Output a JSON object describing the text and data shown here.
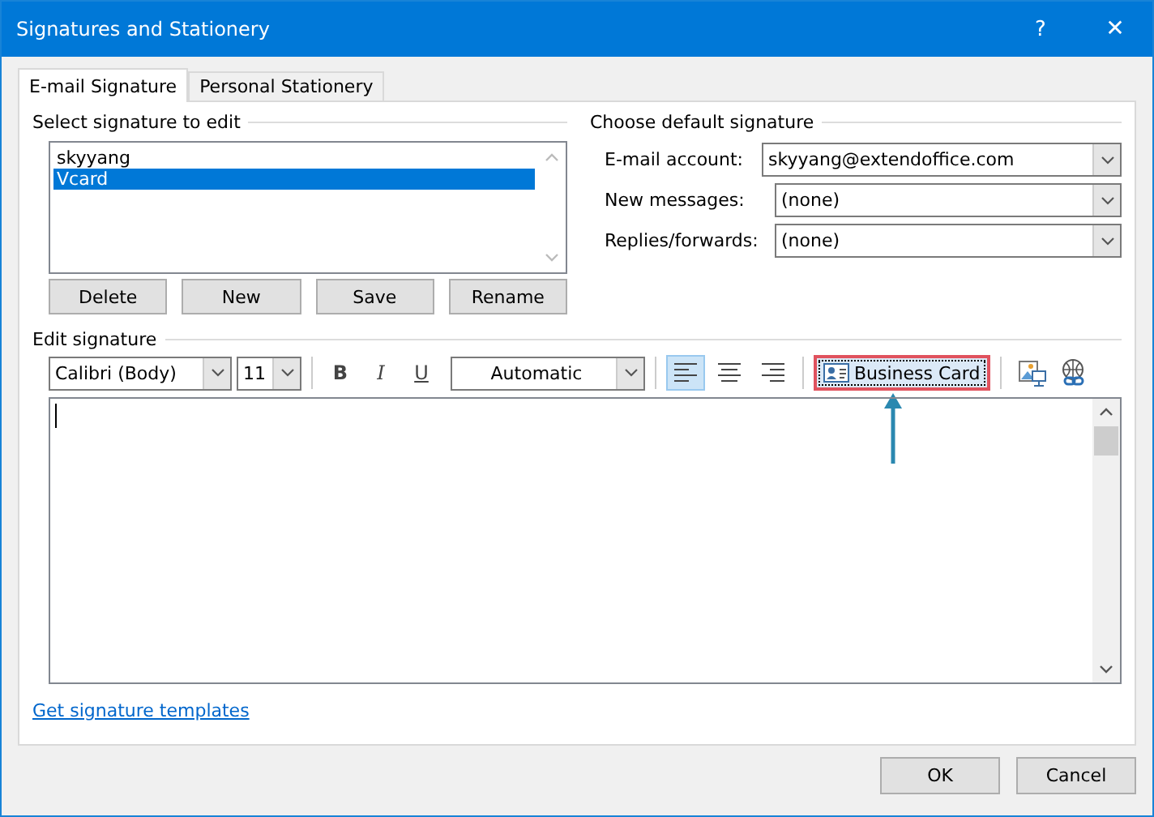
{
  "window": {
    "title": "Signatures and Stationery",
    "buttons": [
      {
        "label": "?",
        "kind": "help"
      },
      {
        "label": "✕",
        "kind": "close"
      }
    ]
  },
  "tabs": [
    {
      "label": "E-mail Signature",
      "selected": true
    },
    {
      "label": "Personal Stationery",
      "selected": false
    }
  ],
  "select_signature": {
    "heading": "Select signature to edit",
    "items": [
      {
        "label": "skyyang",
        "selected": false
      },
      {
        "label": "Vcard",
        "selected": true
      }
    ],
    "buttons": [
      "Delete",
      "New",
      "Save",
      "Rename"
    ]
  },
  "default_signature": {
    "heading": "Choose default signature",
    "fields": [
      {
        "label": "E-mail account:",
        "value": "skyyang@extendoffice.com"
      },
      {
        "label": "New messages:",
        "value": "(none)"
      },
      {
        "label": "Replies/forwards:",
        "value": "(none)"
      }
    ]
  },
  "edit_signature": {
    "heading": "Edit signature",
    "font": "Calibri (Body)",
    "size": "11",
    "format_buttons": [
      {
        "label": "B",
        "kind": "bold"
      },
      {
        "label": "I",
        "kind": "italic"
      },
      {
        "label": "U",
        "kind": "underline"
      }
    ],
    "font_color_choice": "Automatic",
    "align_buttons": [
      {
        "kind": "left",
        "selected": true
      },
      {
        "kind": "center",
        "selected": false
      },
      {
        "kind": "right",
        "selected": false
      }
    ],
    "business_card": "Business Card"
  },
  "link": "Get signature templates",
  "buttons": [
    "OK",
    "Cancel"
  ]
}
